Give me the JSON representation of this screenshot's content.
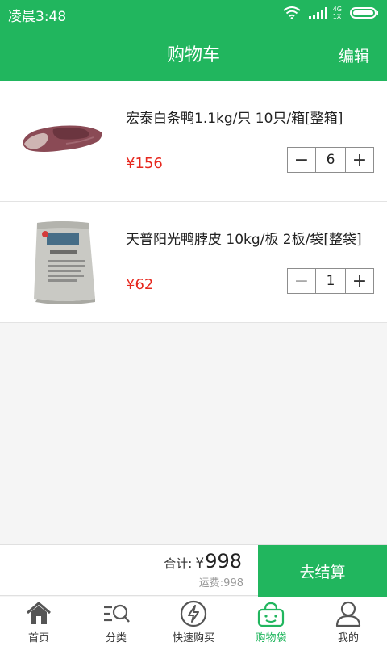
{
  "status": {
    "time": "凌晨3:48",
    "network_top": "4G",
    "network_bottom": "1X"
  },
  "header": {
    "title": "购物车",
    "edit_label": "编辑"
  },
  "cart": {
    "items": [
      {
        "name": "宏泰白条鸭1.1kg/只 10只/箱[整箱]",
        "price": "¥156",
        "quantity": "6",
        "minus_enabled": true,
        "image": "duck-product-image"
      },
      {
        "name": "天普阳光鸭脖皮 10kg/板 2板/袋[整袋]",
        "price": "¥62",
        "quantity": "1",
        "minus_enabled": false,
        "image": "bag-product-image"
      }
    ]
  },
  "summary": {
    "total_label": "合计:",
    "total_currency": "¥",
    "total_value": "998",
    "shipping": "运费:998",
    "checkout_label": "去结算"
  },
  "tabs": [
    {
      "label": "首页",
      "icon": "home-icon",
      "active": false
    },
    {
      "label": "分类",
      "icon": "category-icon",
      "active": false
    },
    {
      "label": "快速购买",
      "icon": "quick-buy-icon",
      "active": false
    },
    {
      "label": "购物袋",
      "icon": "shopping-bag-icon",
      "active": true
    },
    {
      "label": "我的",
      "icon": "profile-icon",
      "active": false
    }
  ],
  "colors": {
    "brand_green": "#21b65e",
    "price_red": "#e6281e"
  }
}
